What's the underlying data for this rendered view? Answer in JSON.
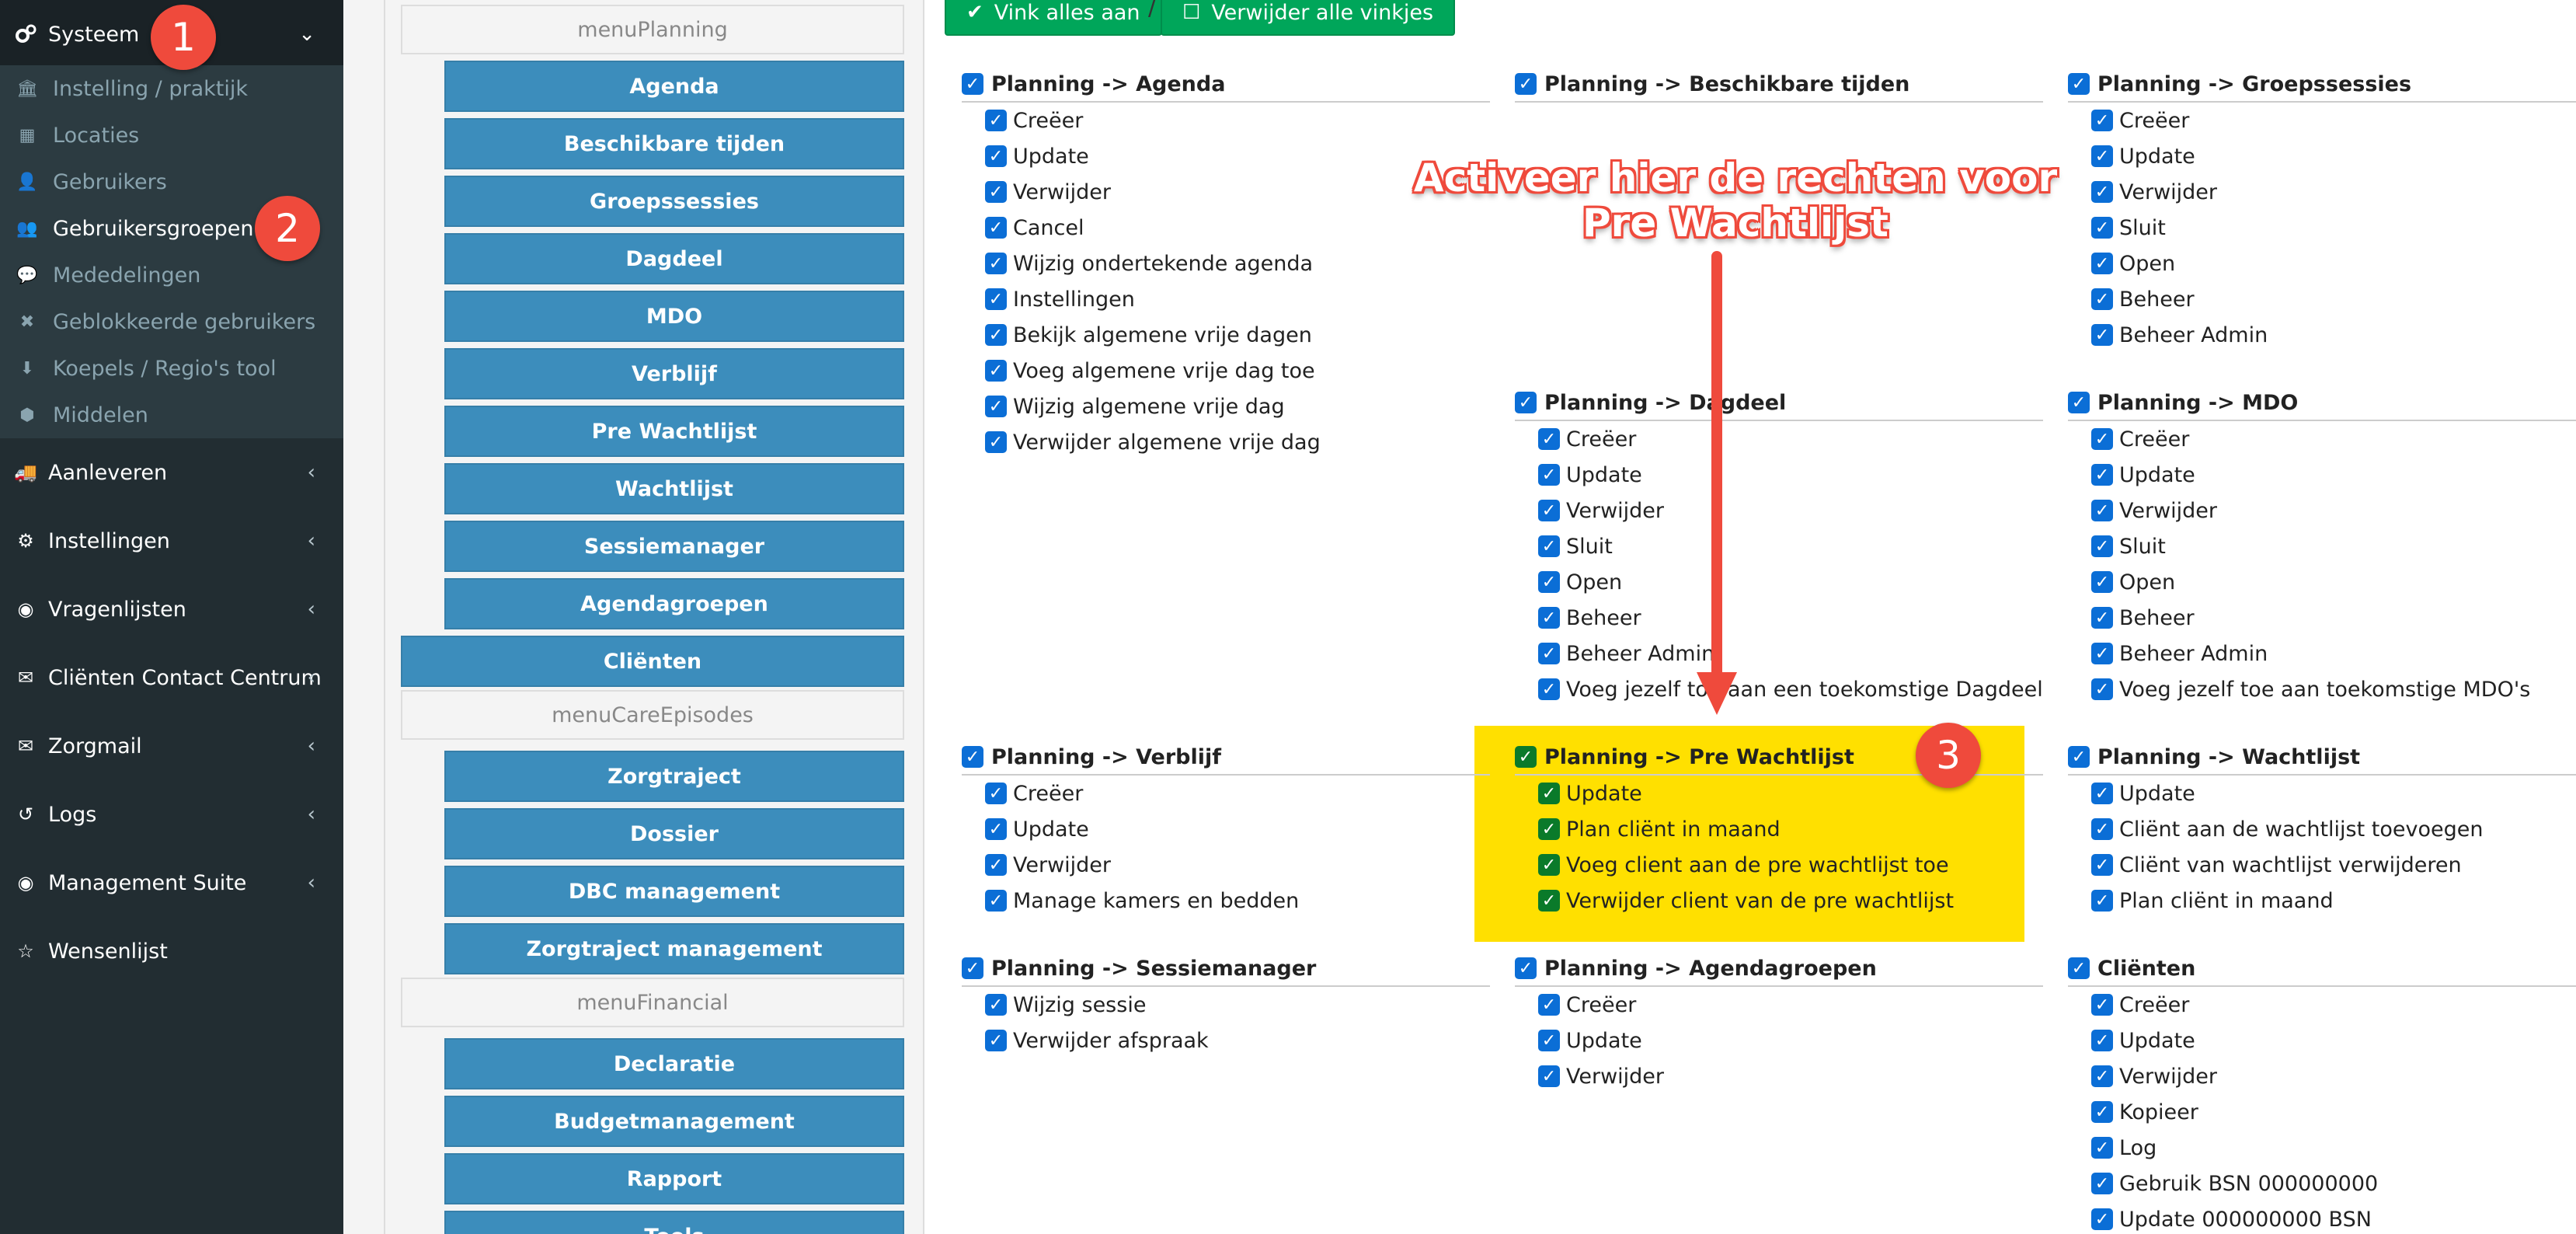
{
  "sidebar": {
    "header": {
      "label": "Systeem",
      "icon": "gears-icon"
    },
    "sub_items": [
      {
        "label": "Instelling / praktijk",
        "icon": "bank-icon"
      },
      {
        "label": "Locaties",
        "icon": "map-icon"
      },
      {
        "label": "Gebruikers",
        "icon": "user-icon"
      },
      {
        "label": "Gebruikersgroepen",
        "icon": "users-icon",
        "active": true
      },
      {
        "label": "Mededelingen",
        "icon": "comments-icon"
      },
      {
        "label": "Geblokkeerde gebruikers",
        "icon": "user-times-icon"
      },
      {
        "label": "Koepels / Regio's tool",
        "icon": "download-icon"
      },
      {
        "label": "Middelen",
        "icon": "cubes-icon"
      }
    ],
    "items": [
      {
        "label": "Aanleveren",
        "icon": "truck-icon"
      },
      {
        "label": "Instellingen",
        "icon": "gear-icon"
      },
      {
        "label": "Vragenlijsten",
        "icon": "globe-icon"
      },
      {
        "label": "Cliënten Contact Centrum",
        "icon": "envelope-icon"
      },
      {
        "label": "Zorgmail",
        "icon": "envelope-icon"
      },
      {
        "label": "Logs",
        "icon": "history-icon"
      },
      {
        "label": "Management Suite",
        "icon": "globe-icon"
      },
      {
        "label": "Wensenlijst",
        "icon": "star-icon"
      }
    ],
    "badges": [
      "1",
      "2"
    ]
  },
  "menutree": {
    "headings": [
      "menuPlanning",
      "menuCareEpisodes",
      "menuFinancial"
    ],
    "planning": [
      "Agenda",
      "Beschikbare tijden",
      "Groepssessies",
      "Dagdeel",
      "MDO",
      "Verblijf",
      "Pre Wachtlijst",
      "Wachtlijst",
      "Sessiemanager",
      "Agendagroepen"
    ],
    "clienten": "Cliënten",
    "care": [
      "Zorgtraject",
      "Dossier",
      "DBC management",
      "Zorgtraject management"
    ],
    "financial": [
      "Declaratie",
      "Budgetmanagement",
      "Rapport",
      "Tools"
    ]
  },
  "toolbar": {
    "check_all": "Vink alles aan",
    "uncheck_all": "Verwijder alle vinkjes",
    "separator": "/"
  },
  "groups": [
    {
      "title": "Planning -> Agenda",
      "items": [
        "Creëer",
        "Update",
        "Verwijder",
        "Cancel",
        "Wijzig ondertekende agenda",
        "Instellingen",
        "Bekijk algemene vrije dagen",
        "Voeg algemene vrije dag toe",
        "Wijzig algemene vrije dag",
        "Verwijder algemene vrije dag"
      ]
    },
    {
      "title": "Planning -> Beschikbare tijden",
      "items": []
    },
    {
      "title": "Planning -> Groepssessies",
      "items": [
        "Creëer",
        "Update",
        "Verwijder",
        "Sluit",
        "Open",
        "Beheer",
        "Beheer Admin"
      ]
    },
    {
      "title": "Planning -> Dagdeel",
      "items": [
        "Creëer",
        "Update",
        "Verwijder",
        "Sluit",
        "Open",
        "Beheer",
        "Beheer Admin",
        "Voeg jezelf toe aan een toekomstige Dagdeel"
      ]
    },
    {
      "title": "Planning -> MDO",
      "items": [
        "Creëer",
        "Update",
        "Verwijder",
        "Sluit",
        "Open",
        "Beheer",
        "Beheer Admin",
        "Voeg jezelf toe aan toekomstige MDO's"
      ]
    },
    {
      "title": "Planning -> Verblijf",
      "items": [
        "Creëer",
        "Update",
        "Verwijder",
        "Manage kamers en bedden"
      ]
    },
    {
      "title": "Planning -> Pre Wachtlijst",
      "items": [
        "Update",
        "Plan cliënt in maand",
        "Voeg client aan de pre wachtlijst toe",
        "Verwijder client van de pre wachtlijst"
      ]
    },
    {
      "title": "Planning -> Wachtlijst",
      "items": [
        "Update",
        "Cliënt aan de wachtlijst toevoegen",
        "Cliënt van wachtlijst verwijderen",
        "Plan cliënt in maand"
      ]
    },
    {
      "title": "Planning -> Sessiemanager",
      "items": [
        "Wijzig sessie",
        "Verwijder afspraak"
      ]
    },
    {
      "title": "Planning -> Agendagroepen",
      "items": [
        "Creëer",
        "Update",
        "Verwijder"
      ]
    },
    {
      "title": "Cliënten",
      "items": [
        "Creëer",
        "Update",
        "Verwijder",
        "Kopieer",
        "Log",
        "Gebruik BSN 000000000",
        "Update 000000000 BSN"
      ]
    }
  ],
  "annotation": {
    "text_line1": "Activeer hier de rechten voor",
    "text_line2": "Pre Wachtlijst",
    "badge": "3",
    "highlight_color": "#ffe000",
    "badge_color": "#ef4a3c"
  },
  "colors": {
    "sidebar": "#222d32",
    "primary": "#3c8dbc",
    "success": "#00a65a",
    "checkbox": "#0b6ed6"
  }
}
